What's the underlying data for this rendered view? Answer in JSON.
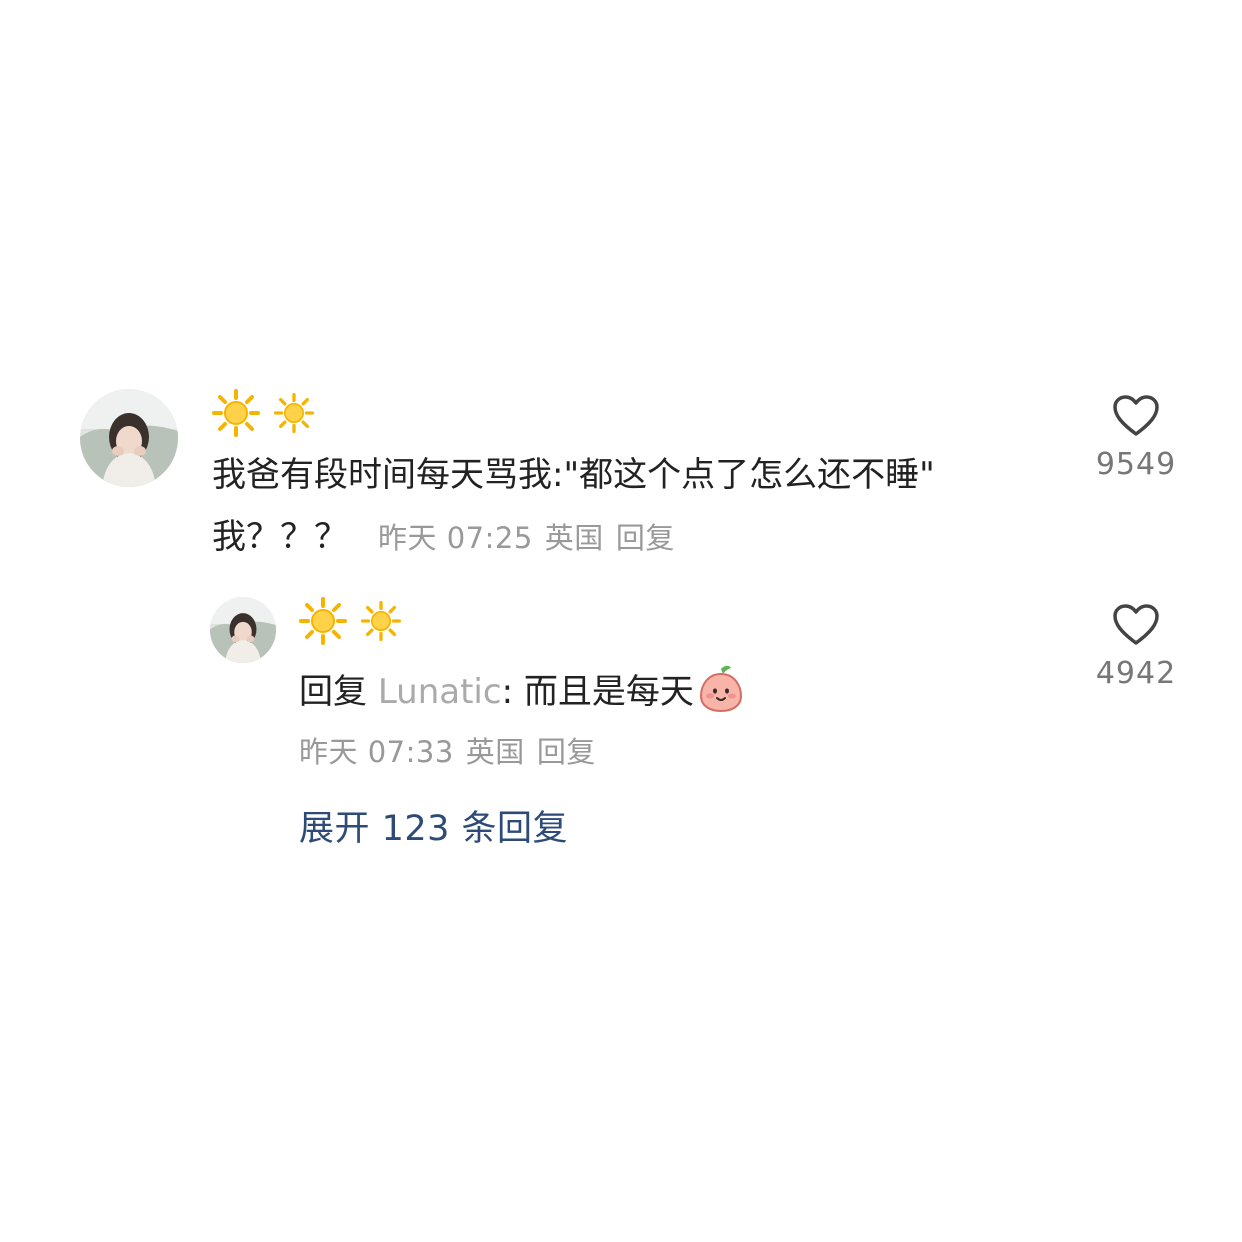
{
  "comment": {
    "username_icons": [
      "sun-icon",
      "sun-icon"
    ],
    "text_line1": "我爸有段时间每天骂我:\"都这个点了怎么还不睡\"",
    "text_line2": "我？？？",
    "time": "昨天 07:25",
    "location": "英国",
    "reply_label": "回复",
    "like_count": "9549"
  },
  "reply": {
    "username_icons": [
      "sun-icon",
      "sun-icon"
    ],
    "prefix": "回复",
    "target": "Lunatic",
    "separator": ": ",
    "text": "而且是每天",
    "emoji": "peach-face-emoji",
    "time": "昨天 07:33",
    "location": "英国",
    "reply_label": "回复",
    "like_count": "4942"
  },
  "expand": {
    "label": "展开 123 条回复"
  },
  "colors": {
    "text": "#222222",
    "meta": "#999999",
    "link": "#2e4b78",
    "sun": "#f5b400"
  }
}
